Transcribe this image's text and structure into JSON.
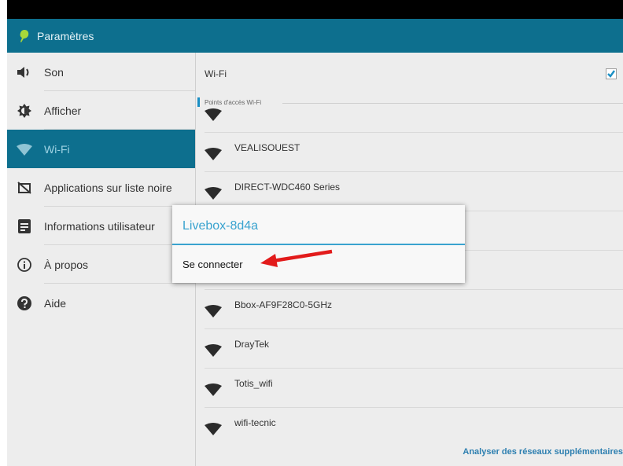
{
  "app": {
    "title": "Paramètres"
  },
  "sidebar": {
    "items": [
      {
        "label": "Son",
        "icon": "speaker-icon",
        "active": false
      },
      {
        "label": "Afficher",
        "icon": "display-icon",
        "active": false
      },
      {
        "label": "Wi-Fi",
        "icon": "wifi-icon",
        "active": true
      },
      {
        "label": "Applications sur liste noire",
        "icon": "blocked-apps-icon",
        "active": false
      },
      {
        "label": "Informations utilisateur",
        "icon": "user-info-icon",
        "active": false
      },
      {
        "label": "À propos",
        "icon": "info-icon",
        "active": false
      },
      {
        "label": "Aide",
        "icon": "help-icon",
        "active": false
      }
    ]
  },
  "wifi": {
    "toggle_label": "Wi-Fi",
    "enabled": true,
    "section_header": "Points d'accès Wi-Fi",
    "networks": [
      {
        "name": ""
      },
      {
        "name": "VEALISOUEST"
      },
      {
        "name": "DIRECT-WDC460 Series"
      },
      {
        "name": ""
      },
      {
        "name": ""
      },
      {
        "name": "Bbox-AF9F28C0-5GHz"
      },
      {
        "name": "DrayTek"
      },
      {
        "name": "Totis_wifi"
      },
      {
        "name": "wifi-tecnic"
      }
    ],
    "scan_more_label": "Analyser des réseaux supplémentaires"
  },
  "dialog": {
    "title": "Livebox-8d4a",
    "connect_label": "Se connecter"
  },
  "colors": {
    "actionbar": "#0d6f8e",
    "accent": "#3aa3cf",
    "arrow": "#e21b1b"
  }
}
